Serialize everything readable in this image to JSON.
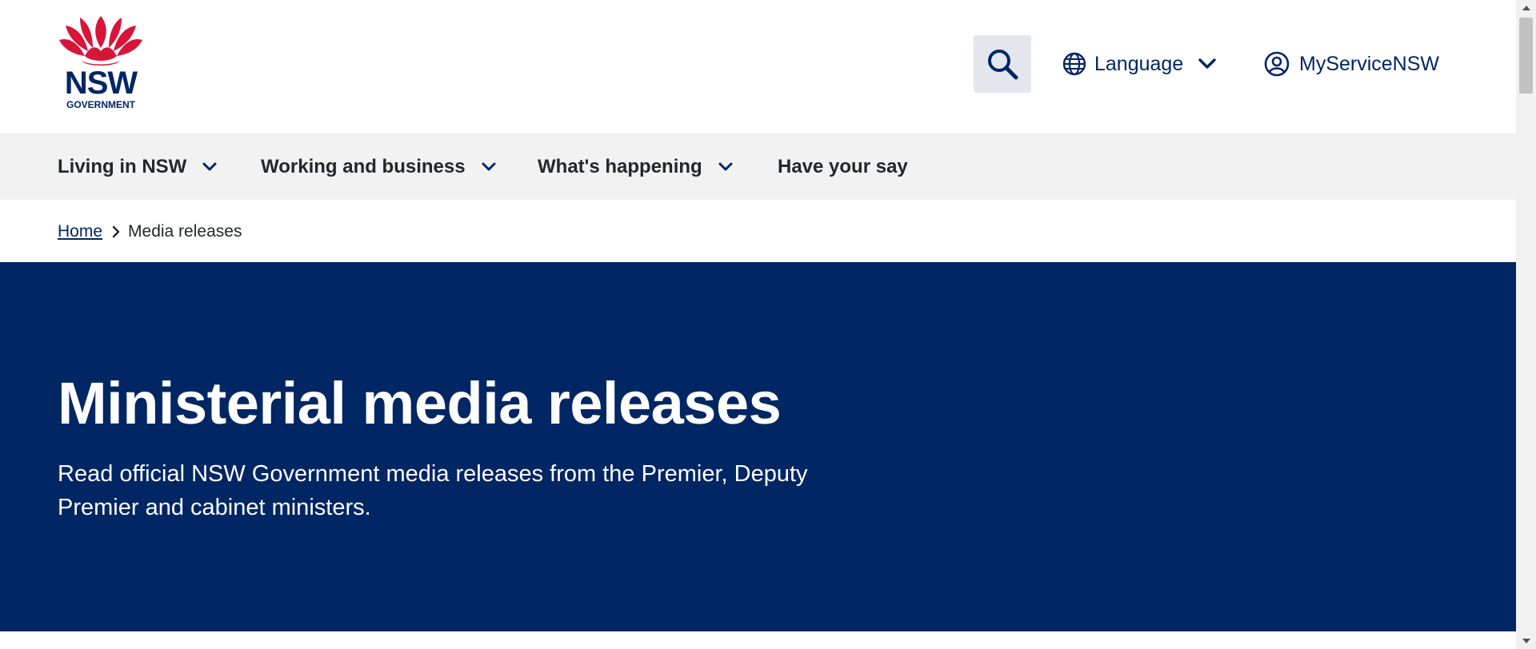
{
  "header": {
    "logo": {
      "wordmark": "NSW",
      "subtext": "GOVERNMENT",
      "icon": "waratah-flower-icon",
      "color": "#d7153a"
    },
    "search": {
      "icon": "search-icon"
    },
    "language": {
      "label": "Language",
      "icon": "globe-icon",
      "chevron": "chevron-down-icon"
    },
    "account": {
      "label": "MyServiceNSW",
      "icon": "user-circle-icon"
    }
  },
  "nav": {
    "items": [
      {
        "label": "Living in NSW",
        "has_dropdown": true
      },
      {
        "label": "Working and business",
        "has_dropdown": true
      },
      {
        "label": "What's happening",
        "has_dropdown": true
      },
      {
        "label": "Have your say",
        "has_dropdown": false
      }
    ]
  },
  "breadcrumb": {
    "home": "Home",
    "current": "Media releases"
  },
  "hero": {
    "title": "Ministerial media releases",
    "text": "Read official NSW Government media releases from the Premier, Deputy Premier and cabinet ministers."
  },
  "colors": {
    "brand_navy": "#002664",
    "brand_red": "#d7153a",
    "nav_bg": "#f2f2f2",
    "search_bg": "#e3e6ed"
  }
}
